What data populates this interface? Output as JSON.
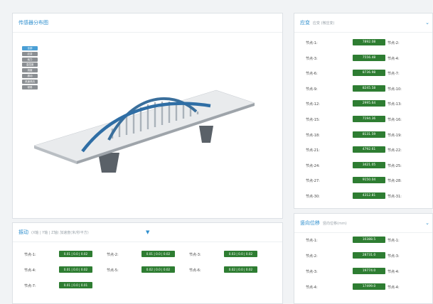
{
  "sensor_panel": {
    "title": "传感器分布图",
    "toolbar": [
      {
        "label": "全部",
        "active": true
      },
      {
        "label": "应变"
      },
      {
        "label": "索力"
      },
      {
        "label": "温湿度"
      },
      {
        "label": "挠度"
      },
      {
        "label": "振动"
      },
      {
        "label": "风速风向"
      },
      {
        "label": "倾角"
      }
    ]
  },
  "strain_panel": {
    "title": "应变",
    "subtitle": "应变 (微应变)",
    "rows": [
      {
        "l1": "节点-1:",
        "value": "7892.08",
        "l2": "节点-2:"
      },
      {
        "l1": "节点-3:",
        "value": "7556.48",
        "l2": "节点-4:"
      },
      {
        "l1": "节点-6:",
        "value": "8736.98",
        "l2": "节点-7:"
      },
      {
        "l1": "节点-9:",
        "value": "8245.58",
        "l2": "节点-10:"
      },
      {
        "l1": "节点-12:",
        "value": "2995.64",
        "l2": "节点-13:"
      },
      {
        "l1": "节点-15:",
        "value": "7194.36",
        "l2": "节点-16:"
      },
      {
        "l1": "节点-18:",
        "value": "8131.59",
        "l2": "节点-19:"
      },
      {
        "l1": "节点-21:",
        "value": "4792.61",
        "l2": "节点-22:"
      },
      {
        "l1": "节点-24:",
        "value": "3421.05",
        "l2": "节点-25:"
      },
      {
        "l1": "节点-27:",
        "value": "9150.04",
        "l2": "节点-28:"
      },
      {
        "l1": "节点-30:",
        "value": "4312.81",
        "l2": "节点-31:"
      }
    ]
  },
  "accel_panel": {
    "title": "振动",
    "subtitle": "(X轴 | Y轴 | Z轴) 加速度(米/秒平方)",
    "rows": [
      [
        {
          "label": "节点-1:",
          "value": "0.01 | 0.0 | 0.02"
        },
        {
          "label": "节点-2:",
          "value": "0.01 | 0.0 | 0.02"
        },
        {
          "label": "节点-3:",
          "value": "0.03 | 0.0 | 0.02"
        }
      ],
      [
        {
          "label": "节点-4:",
          "value": "0.01 | 0.0 | 0.02"
        },
        {
          "label": "节点-5:",
          "value": "0.02 | 0.0 | 0.02"
        },
        {
          "label": "节点-6:",
          "value": "0.02 | 0.0 | 0.02"
        }
      ],
      [
        {
          "label": "节点-7:",
          "value": "0.01 | 0.0 | 0.01"
        }
      ]
    ]
  },
  "disp_panel": {
    "title": "竖向位移",
    "subtitle": "竖向位移(mm)",
    "rows": [
      {
        "l1": "节点-1:",
        "value": "10388.5",
        "l2": "节点-1:"
      },
      {
        "l1": "节点-2:",
        "value": "28731.0",
        "l2": "节点-3:"
      },
      {
        "l1": "节点-3:",
        "value": "19774.0",
        "l2": "节点-4:"
      },
      {
        "l1": "节点-4:",
        "value": "17499.0",
        "l2": "节点-4:"
      }
    ]
  }
}
